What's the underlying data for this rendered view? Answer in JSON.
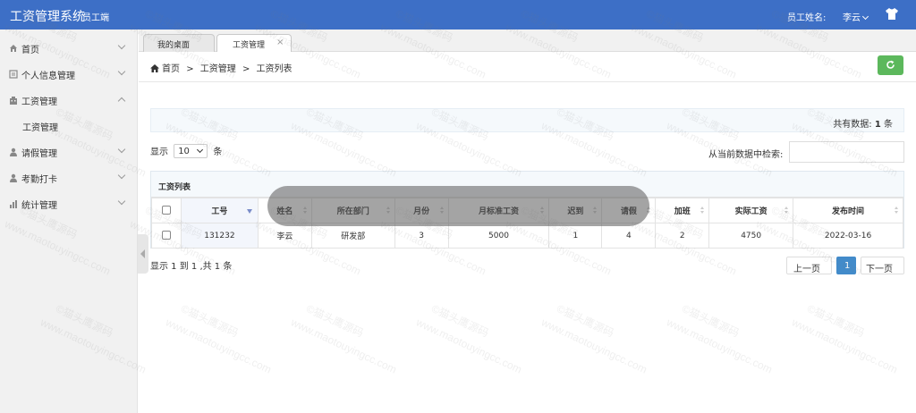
{
  "topbar": {
    "title": "工资管理系统",
    "subtitle": "员工端",
    "user_label": "员工姓名:",
    "user_name": "李云",
    "shirt_icon": "tshirt-icon"
  },
  "sidebar": {
    "items": [
      {
        "label": "首页",
        "icon": "home-icon"
      },
      {
        "label": "个人信息管理",
        "icon": "list-icon"
      },
      {
        "label": "工资管理",
        "icon": "building-icon"
      },
      {
        "label": "请假管理",
        "icon": "user-icon"
      },
      {
        "label": "考勤打卡",
        "icon": "user-icon"
      },
      {
        "label": "统计管理",
        "icon": "chart-icon"
      }
    ],
    "sub_items": [
      {
        "label": "工资管理"
      }
    ]
  },
  "tabs": [
    {
      "label": "我的桌面"
    },
    {
      "label": "工资管理",
      "close": "×"
    }
  ],
  "breadcrumb": {
    "items": [
      "首页",
      ">",
      "工资管理",
      ">",
      "工资列表"
    ]
  },
  "infobar": {
    "label": "共有数据:",
    "count": "1",
    "unit": "条"
  },
  "length_menu": {
    "prefix": "显示",
    "value": "10",
    "suffix": "条"
  },
  "search": {
    "label": "从当前数据中检索:",
    "value": ""
  },
  "table": {
    "title": "工资列表",
    "headers": [
      "工号",
      "姓名",
      "所在部门",
      "月份",
      "月标准工资",
      "迟到",
      "请假",
      "加班",
      "实际工资",
      "发布时间"
    ],
    "rows": [
      [
        "131232",
        "李云",
        "研发部",
        "3",
        "5000",
        "1",
        "4",
        "2",
        "4750",
        "2022-03-16"
      ]
    ]
  },
  "summary": "显示 1 到 1 ,共 1 条",
  "pagination": {
    "prev": "上一页",
    "current": "1",
    "next": "下一页"
  },
  "watermark": {
    "text1": "©猫头鹰源码",
    "text2": "www.maotouyingcc.com"
  },
  "colors": {
    "topbar": "#3d6fc6",
    "refresh": "#5cb85c",
    "page_current": "#428bca"
  }
}
